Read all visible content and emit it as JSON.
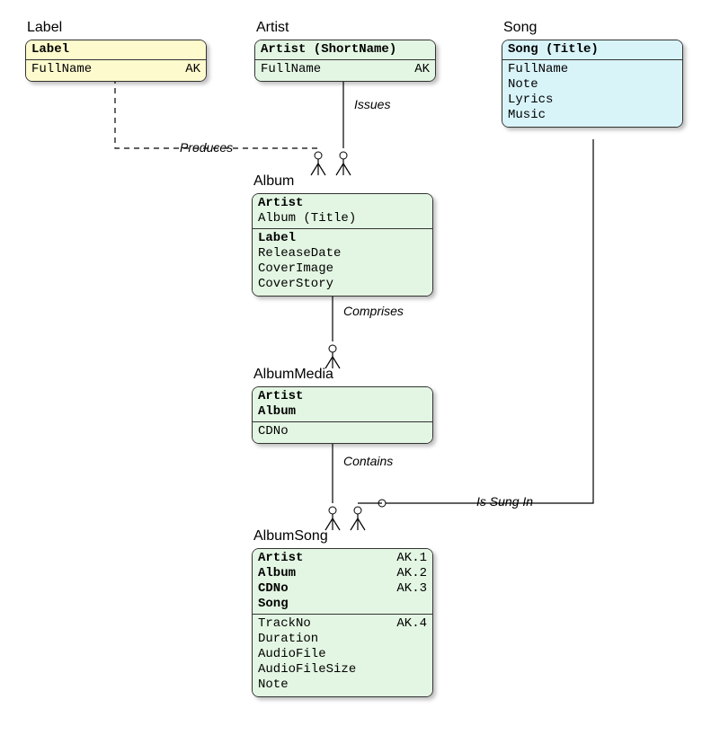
{
  "entities": {
    "label": {
      "title": "Label",
      "header": [
        {
          "name": "Label",
          "bold": true,
          "ak": ""
        }
      ],
      "body": [
        {
          "name": "FullName",
          "bold": false,
          "ak": "AK"
        }
      ]
    },
    "artist": {
      "title": "Artist",
      "header": [
        {
          "name": "Artist (ShortName)",
          "bold": true,
          "ak": ""
        }
      ],
      "body": [
        {
          "name": "FullName",
          "bold": false,
          "ak": "AK"
        }
      ]
    },
    "song": {
      "title": "Song",
      "header": [
        {
          "name": "Song (Title)",
          "bold": true,
          "ak": ""
        }
      ],
      "body": [
        {
          "name": "FullName",
          "bold": false,
          "ak": ""
        },
        {
          "name": "Note",
          "bold": false,
          "ak": ""
        },
        {
          "name": "Lyrics",
          "bold": false,
          "ak": ""
        },
        {
          "name": "Music",
          "bold": false,
          "ak": ""
        }
      ]
    },
    "album": {
      "title": "Album",
      "header": [
        {
          "name": "Artist",
          "bold": true,
          "ak": ""
        },
        {
          "name": "Album (Title)",
          "bold": false,
          "ak": ""
        }
      ],
      "body": [
        {
          "name": "Label",
          "bold": true,
          "ak": ""
        },
        {
          "name": "ReleaseDate",
          "bold": false,
          "ak": ""
        },
        {
          "name": "CoverImage",
          "bold": false,
          "ak": ""
        },
        {
          "name": "CoverStory",
          "bold": false,
          "ak": ""
        }
      ]
    },
    "albummedia": {
      "title": "AlbumMedia",
      "header": [
        {
          "name": "Artist",
          "bold": true,
          "ak": ""
        },
        {
          "name": "Album",
          "bold": true,
          "ak": ""
        }
      ],
      "body": [
        {
          "name": "CDNo",
          "bold": false,
          "ak": ""
        }
      ]
    },
    "albumsong": {
      "title": "AlbumSong",
      "header": [
        {
          "name": "Artist",
          "bold": true,
          "ak": "AK.1"
        },
        {
          "name": "Album",
          "bold": true,
          "ak": "AK.2"
        },
        {
          "name": "CDNo",
          "bold": true,
          "ak": "AK.3"
        },
        {
          "name": "Song",
          "bold": true,
          "ak": ""
        }
      ],
      "body": [
        {
          "name": "TrackNo",
          "bold": false,
          "ak": "AK.4"
        },
        {
          "name": "Duration",
          "bold": false,
          "ak": ""
        },
        {
          "name": "AudioFile",
          "bold": false,
          "ak": ""
        },
        {
          "name": "AudioFileSize",
          "bold": false,
          "ak": ""
        },
        {
          "name": "Note",
          "bold": false,
          "ak": ""
        }
      ]
    }
  },
  "relationships": {
    "produces": "Produces",
    "issues": "Issues",
    "comprises": "Comprises",
    "contains": "Contains",
    "issungin": "Is Sung In"
  }
}
